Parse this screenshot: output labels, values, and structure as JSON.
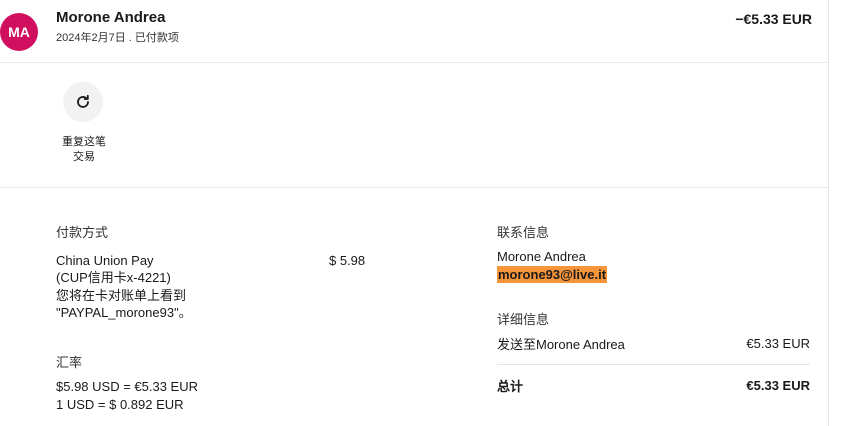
{
  "header": {
    "avatar_initials": "MA",
    "avatar_color": "#d0105f",
    "name": "Morone Andrea",
    "date_status": "2024年2月7日 . 已付款项",
    "amount": "−€5.33 EUR"
  },
  "repeat": {
    "icon": "refresh-icon",
    "label_line1": "重复这笔",
    "label_line2": "交易"
  },
  "payment": {
    "title": "付款方式",
    "method_name": "China Union Pay",
    "card": "(CUP信用卡x-4221)",
    "statement_note": "您将在卡对账单上看到",
    "statement_name": "\"PAYPAL_morone93\"。",
    "amount": "$ 5.98"
  },
  "exchange": {
    "title": "汇率",
    "line1": "$5.98 USD = €5.33 EUR",
    "line2": "1 USD = $ 0.892 EUR"
  },
  "contact": {
    "title": "联系信息",
    "name": "Morone Andrea",
    "email": "morone93@live.it",
    "highlight_color": "#f7953a"
  },
  "details": {
    "title": "详细信息",
    "sent_to_label": "发送至Morone Andrea",
    "sent_to_amount": "€5.33 EUR",
    "total_label": "总计",
    "total_amount": "€5.33 EUR"
  }
}
